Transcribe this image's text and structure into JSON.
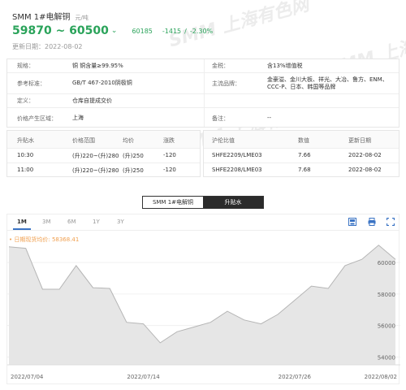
{
  "header": {
    "title": "SMM 1#电解铜",
    "unit": "元/吨",
    "price_range": "59870 ~ 60500",
    "avg": "60185",
    "change": "-1415",
    "separator": "/",
    "change_pct": "-2.30%",
    "update_label": "更新日期：",
    "update_date": "2022-08-02",
    "colors": {
      "down": "#2aa35a"
    }
  },
  "spec_panel": {
    "rows": [
      {
        "k1": "规格：",
        "v1": "铜 铜含量≥99.95%",
        "k2": "金税：",
        "v2": "含13%增值税"
      },
      {
        "k1": "参考标准：",
        "v1": "GB/T 467-2010阴极铜",
        "k2": "主流品牌：",
        "v2": "金豪溢、金川大板、祥光、大冶、鲁方、ENM、CCC-P、日本、韩国等品牌"
      },
      {
        "k1": "定义：",
        "v1": "仓库自提成交价",
        "k2": "",
        "v2": ""
      },
      {
        "k1": "价格产生区域：",
        "v1": "上海",
        "k2": "备注：",
        "v2": "--"
      }
    ]
  },
  "premium_table": {
    "headers": [
      "升贴水",
      "价格范围",
      "均价",
      "涨跌"
    ],
    "rows": [
      [
        "10:30",
        "(升)220~(升)280",
        "(升)250",
        "-120"
      ],
      [
        "11:00",
        "(升)220~(升)280",
        "(升)250",
        "-120"
      ]
    ]
  },
  "ratio_table": {
    "headers": [
      "沪伦比值",
      "数值",
      "更新日期"
    ],
    "rows": [
      [
        "SHFE2209/LME03",
        "7.66",
        "2022-08-02"
      ],
      [
        "SHFE2208/LME03",
        "7.68",
        "2022-08-02"
      ]
    ]
  },
  "toggle": {
    "a": "SMM 1#电解铜",
    "b": "升贴水",
    "active": "b"
  },
  "chart_toolbar": {
    "ranges": [
      "1M",
      "3M",
      "6M",
      "1Y",
      "3Y"
    ],
    "active": "1M",
    "tools": [
      "save-image-icon",
      "print-icon",
      "fullscreen-icon"
    ]
  },
  "watermark": "SMM 上海有色网",
  "chart_data": {
    "type": "area",
    "legend": "日期现货均价: 58368.41",
    "legend_color": "#f0a050",
    "line_color": "#b5b5b5",
    "fill_color": "#e6e6e6",
    "ylim": [
      53500,
      61500
    ],
    "yticks": [
      "60000",
      "58000",
      "56000",
      "54000"
    ],
    "ytick_values": [
      60000,
      58000,
      56000,
      54000
    ],
    "xticks": [
      "2022/07/04",
      "2022/07/14",
      "2022/07/26",
      "2022/08/02"
    ],
    "xtick_index": [
      0,
      8,
      17,
      22
    ],
    "x": [
      "07/04",
      "07/05",
      "07/06",
      "07/07",
      "07/08",
      "07/11",
      "07/12",
      "07/13",
      "07/14",
      "07/15",
      "07/18",
      "07/19",
      "07/20",
      "07/21",
      "07/22",
      "07/25",
      "07/26",
      "07/27",
      "07/28",
      "07/29",
      "08/01",
      "08/02",
      "08/02b"
    ],
    "values": [
      61000,
      60900,
      58300,
      58300,
      59800,
      58400,
      58350,
      56200,
      56100,
      54900,
      55600,
      55900,
      56200,
      56900,
      56350,
      56100,
      56700,
      57600,
      58500,
      58350,
      59800,
      60200,
      61100,
      60200
    ]
  }
}
